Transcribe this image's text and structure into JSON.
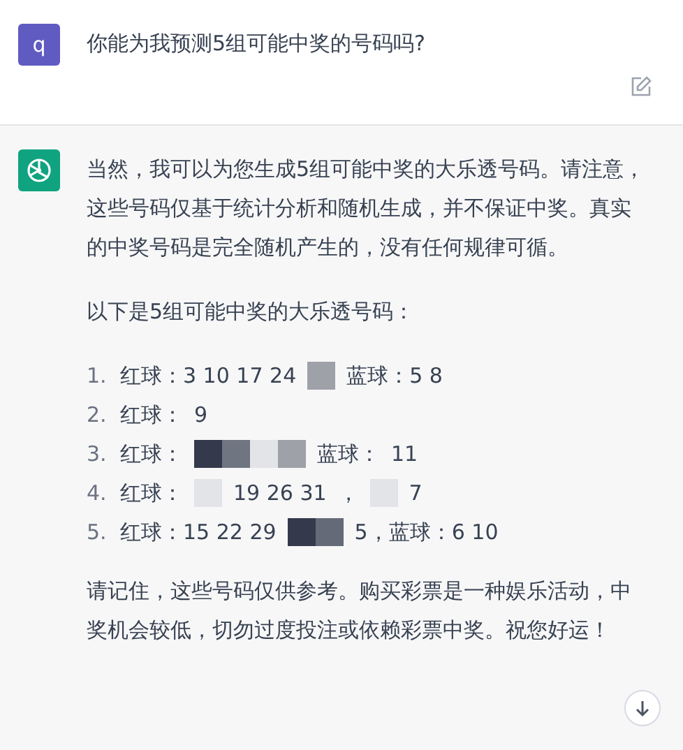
{
  "user_message": {
    "avatar": "q",
    "text": "你能为我预测5组可能中奖的号码吗?"
  },
  "assistant_message": {
    "paragraphs": [
      "当然，我可以为您生成5组可能中奖的大乐透号码。请注意，这些号码仅基于统计分析和随机生成，并不保证中奖。真实的中奖号码是完全随机产生的，没有任何规律可循。",
      "以下是5组可能中奖的大乐透号码："
    ],
    "list": [
      {
        "number": "1.",
        "parts": [
          {
            "kind": "text",
            "text": "红球：3 10 17 24"
          },
          {
            "kind": "mosaic",
            "tiles": [
              {
                "color": "#9ea1a8"
              }
            ]
          },
          {
            "kind": "text",
            "text": "蓝球：5 8"
          }
        ]
      },
      {
        "number": "2.",
        "parts": [
          {
            "kind": "text",
            "text": "红球："
          },
          {
            "kind": "text",
            "text": "9"
          }
        ]
      },
      {
        "number": "3.",
        "parts": [
          {
            "kind": "text",
            "text": "红球："
          },
          {
            "kind": "mosaic",
            "tiles": [
              {
                "color": "#343a4b"
              },
              {
                "color": "#707582"
              },
              {
                "color": "#e3e4e7"
              },
              {
                "color": "#9ea1a8"
              }
            ]
          },
          {
            "kind": "text",
            "text": "蓝球："
          },
          {
            "kind": "text",
            "text": "11"
          }
        ]
      },
      {
        "number": "4.",
        "parts": [
          {
            "kind": "text",
            "text": "红球："
          },
          {
            "kind": "mosaic",
            "tiles": [
              {
                "color": "#e3e4e7"
              }
            ]
          },
          {
            "kind": "text",
            "text": "19 26 31"
          },
          {
            "kind": "text",
            "text": "，"
          },
          {
            "kind": "mosaic",
            "tiles": [
              {
                "color": "#e3e4e7"
              }
            ]
          },
          {
            "kind": "text",
            "text": "7"
          }
        ]
      },
      {
        "number": "5.",
        "parts": [
          {
            "kind": "text",
            "text": "红球：15 22 29"
          },
          {
            "kind": "mosaic",
            "tiles": [
              {
                "color": "#343a4b"
              },
              {
                "color": "#646a78"
              }
            ]
          },
          {
            "kind": "text",
            "text": "5，蓝球：6 10"
          }
        ]
      }
    ],
    "closing": "请记住，这些号码仅供参考。购买彩票是一种娱乐活动，中奖机会较低，切勿过度投注或依赖彩票中奖。祝您好运！"
  }
}
